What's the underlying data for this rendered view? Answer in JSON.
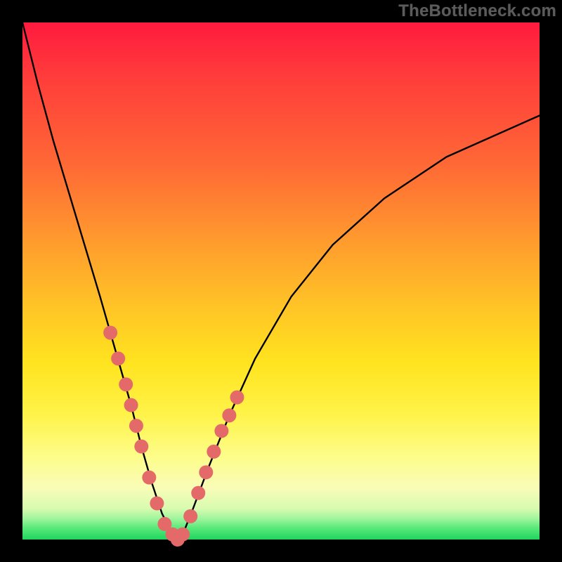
{
  "watermark": "TheBottleneck.com",
  "chart_data": {
    "type": "line",
    "title": "",
    "xlabel": "",
    "ylabel": "",
    "xlim": [
      0,
      100
    ],
    "ylim": [
      0,
      100
    ],
    "series": [
      {
        "name": "bottleneck-curve",
        "x": [
          0,
          3,
          6,
          9,
          12,
          15,
          17,
          19,
          21,
          23,
          25,
          27,
          29,
          30,
          31,
          33,
          36,
          40,
          45,
          52,
          60,
          70,
          82,
          100
        ],
        "values": [
          100,
          88,
          77,
          67,
          57,
          47,
          40,
          33,
          26,
          18,
          11,
          5,
          1,
          0,
          1,
          6,
          14,
          24,
          35,
          47,
          57,
          66,
          74,
          82
        ]
      }
    ],
    "markers": {
      "name": "highlight-dots",
      "color": "#e46a6a",
      "radius_px": 10,
      "x": [
        17.0,
        18.5,
        20.0,
        21.0,
        22.0,
        23.0,
        24.5,
        26.0,
        27.5,
        29.0,
        30.0,
        31.0,
        32.5,
        34.0,
        35.5,
        37.0,
        38.5,
        40.0,
        41.5
      ],
      "values": [
        40.0,
        35.0,
        30.0,
        26.0,
        22.0,
        18.0,
        12.0,
        7.0,
        3.0,
        1.0,
        0.0,
        1.0,
        4.5,
        9.0,
        13.0,
        17.0,
        21.0,
        24.0,
        27.5
      ]
    }
  },
  "colors": {
    "curve": "#000000",
    "marker": "#e46a6a",
    "frame": "#000000"
  }
}
